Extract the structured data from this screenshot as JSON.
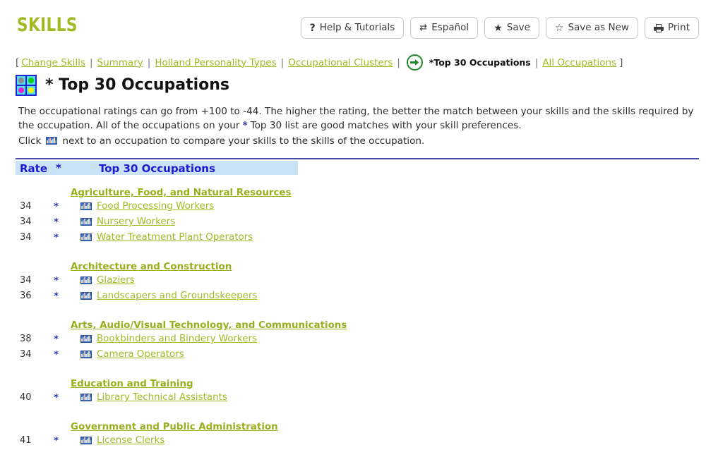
{
  "header": {
    "brand": "SKILLS",
    "buttons": [
      {
        "icon": "question-mark-icon",
        "label": "Help & Tutorials"
      },
      {
        "icon": "swap-arrows-icon",
        "label": "Español"
      },
      {
        "icon": "star-filled-icon",
        "label": "Save"
      },
      {
        "icon": "star-outline-icon",
        "label": "Save as New"
      },
      {
        "icon": "printer-icon",
        "label": "Print"
      }
    ]
  },
  "nav": {
    "open_bracket": "[",
    "close_bracket": "]",
    "separator": "|",
    "links": [
      "Change Skills",
      "Summary",
      "Holland Personality Types",
      "Occupational Clusters"
    ],
    "current": "*Top 30 Occupations",
    "last_link": "All Occupations"
  },
  "page": {
    "title": "* Top 30 Occupations",
    "icon_colors": [
      "#8c8c8c",
      "#11cc11",
      "#ee22cc",
      "#f2f20a"
    ]
  },
  "intro": {
    "line1_a": "The occupational ratings can go from +100 to -44. The higher the rating, the better the match between your skills and the skills required by the occupation. All of the occupations on your",
    "asterisk": "*",
    "line1_b": "Top 30 list are good matches with your skill preferences.",
    "line2_a": "Click",
    "line2_b": "next to an occupation to compare your skills to the skills of the occupation."
  },
  "table": {
    "columns": {
      "rate": "Rate",
      "asterisk": "*",
      "title": "Top 30 Occupations"
    },
    "clusters": [
      {
        "name": "Agriculture, Food, and Natural Resources",
        "occupations": [
          {
            "rate": "34",
            "star": "*",
            "name": "Food Processing Workers"
          },
          {
            "rate": "34",
            "star": "*",
            "name": "Nursery Workers"
          },
          {
            "rate": "34",
            "star": "*",
            "name": "Water Treatment Plant Operators"
          }
        ]
      },
      {
        "name": "Architecture and Construction",
        "occupations": [
          {
            "rate": "34",
            "star": "*",
            "name": "Glaziers"
          },
          {
            "rate": "36",
            "star": "*",
            "name": "Landscapers and Groundskeepers"
          }
        ]
      },
      {
        "name": "Arts, Audio/Visual Technology, and Communications",
        "occupations": [
          {
            "rate": "38",
            "star": "*",
            "name": "Bookbinders and Bindery Workers"
          },
          {
            "rate": "34",
            "star": "*",
            "name": "Camera Operators"
          }
        ]
      },
      {
        "name": "Education and Training",
        "occupations": [
          {
            "rate": "40",
            "star": "*",
            "name": "Library Technical Assistants"
          }
        ]
      },
      {
        "name": "Government and Public Administration",
        "occupations": [
          {
            "rate": "41",
            "star": "*",
            "name": "License Clerks"
          }
        ]
      }
    ]
  },
  "colors": {
    "brand": "#a3b823",
    "link": "#a3b823",
    "header_band": "#c9e2f5",
    "header_text": "#1a1ad0",
    "rule": "#4a4aa8",
    "asterisk": "#2b3fb0"
  }
}
